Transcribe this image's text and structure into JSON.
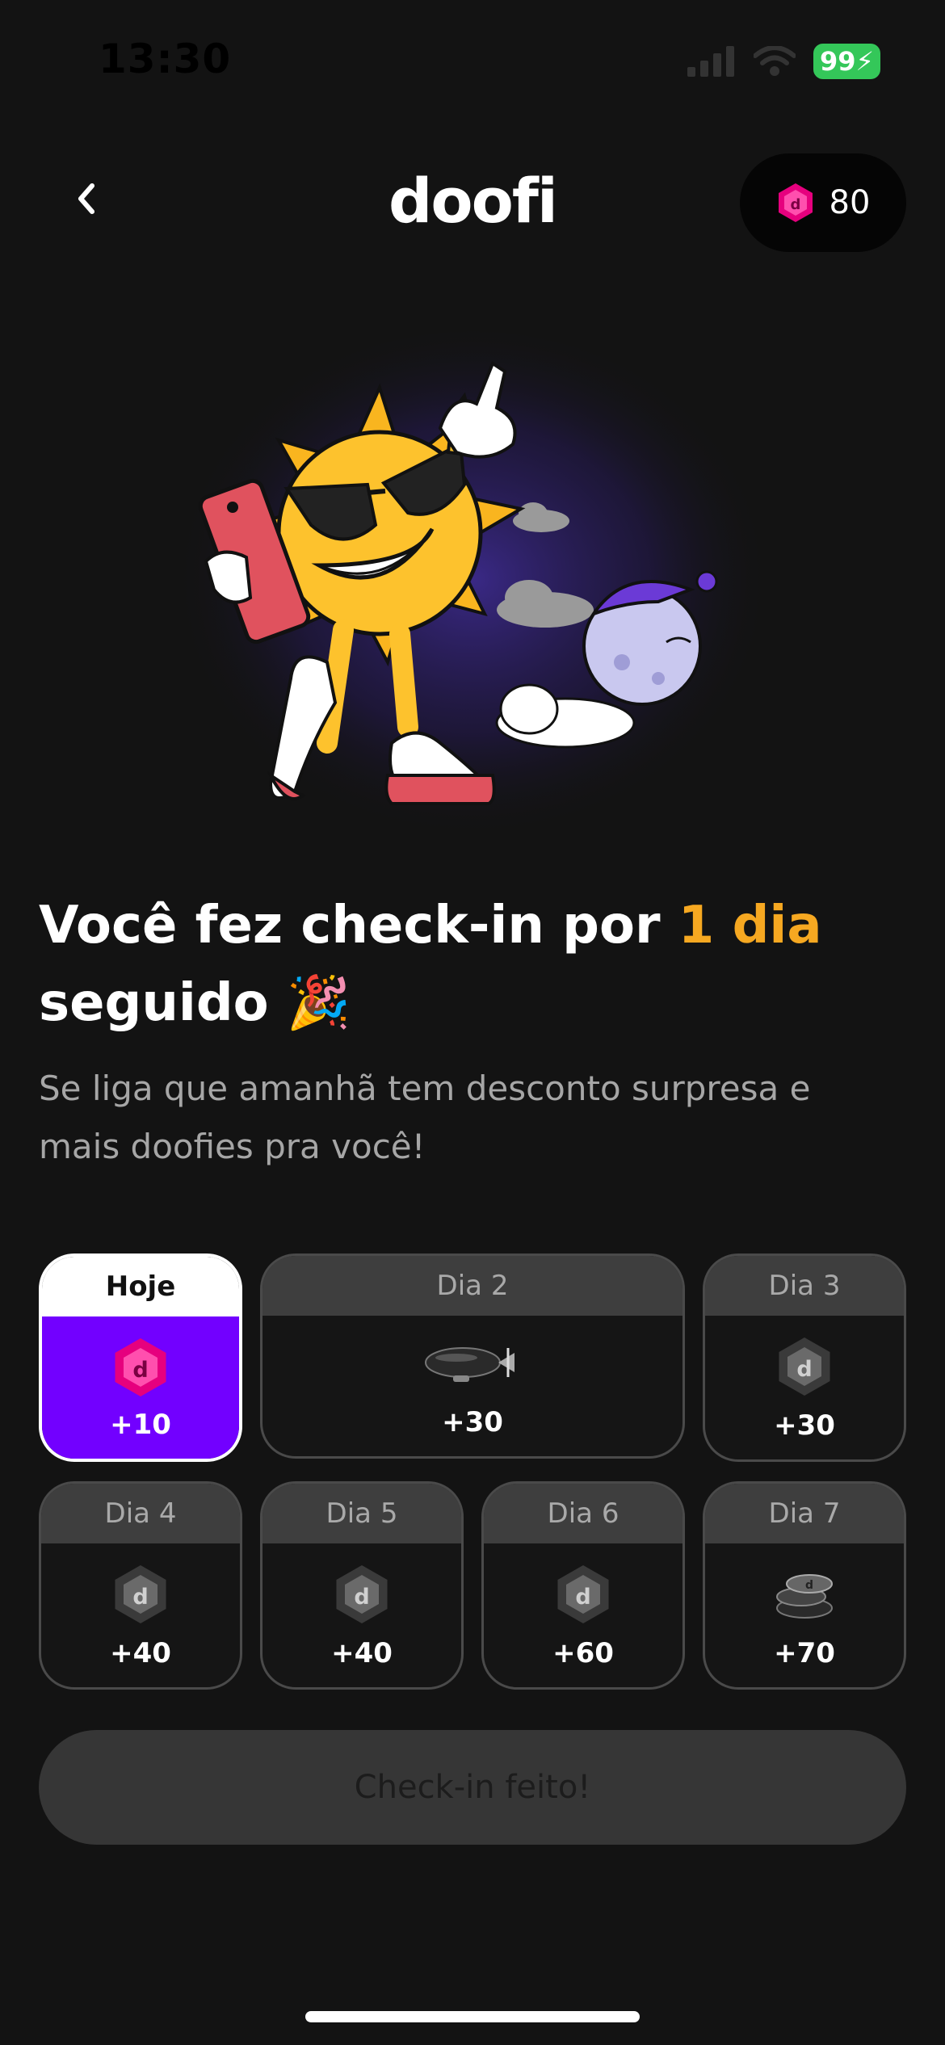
{
  "status_bar": {
    "time": "13:30",
    "battery": "99"
  },
  "header": {
    "logo": "doofi",
    "coins": "80"
  },
  "headline": {
    "prefix": "Você fez check-in por ",
    "highlight": "1 dia",
    "suffix": "seguido",
    "emoji": "🎉"
  },
  "subtitle": "Se liga que amanhã tem desconto surpresa e mais doofies pra você!",
  "rewards": [
    {
      "label": "Hoje",
      "amount": "+10",
      "icon": "doofi-coin-icon"
    },
    {
      "label": "Dia 2",
      "amount": "+30",
      "icon": "blimp-icon"
    },
    {
      "label": "Dia 3",
      "amount": "+30",
      "icon": "coin-icon"
    },
    {
      "label": "Dia 4",
      "amount": "+40",
      "icon": "coin-icon"
    },
    {
      "label": "Dia 5",
      "amount": "+40",
      "icon": "coin-icon"
    },
    {
      "label": "Dia 6",
      "amount": "+60",
      "icon": "coin-icon"
    },
    {
      "label": "Dia 7",
      "amount": "+70",
      "icon": "coin-stack-icon"
    }
  ],
  "checkin_button": "Check-in feito!",
  "colors": {
    "background": "#131313",
    "accent": "#f6a821",
    "today": "#7200ff",
    "coin": "#e6007e"
  }
}
